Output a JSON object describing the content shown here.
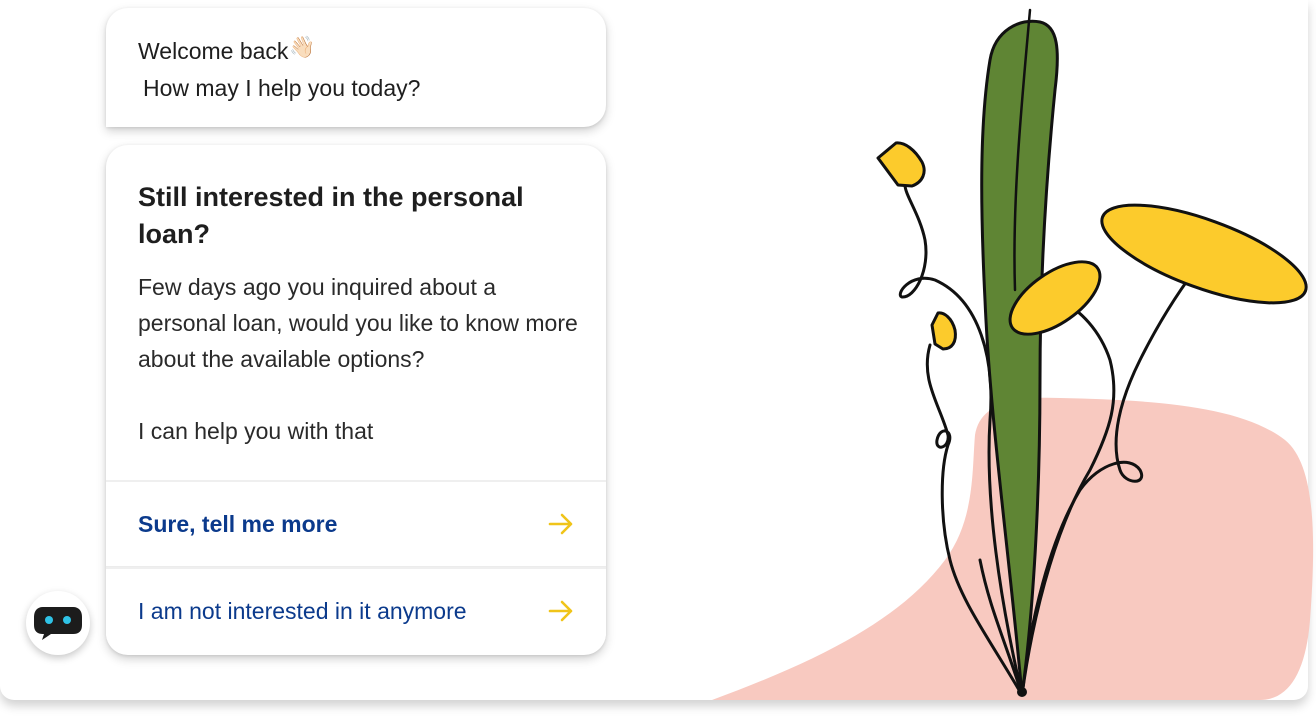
{
  "welcome": {
    "greeting": "Welcome back",
    "wave_emoji": "👋🏻",
    "question": "How may I help you today?"
  },
  "offer": {
    "title": "Still interested in the personal loan?",
    "body_lines": [
      "Few days ago you inquired about a personal loan, would you like to know more about the available options?",
      "I can help you with that"
    ]
  },
  "options": [
    {
      "label": "Sure, tell me more",
      "icon": "arrow-right-icon"
    },
    {
      "label": "I am not interested in it anymore",
      "icon": "arrow-right-icon"
    }
  ],
  "bot": {
    "icon": "chatbot-icon"
  },
  "colors": {
    "option_text": "#0b3a8c",
    "arrow": "#f0c419",
    "leaf_green": "#5f8534",
    "flower_yellow": "#fccb2c",
    "blob_pink": "#f8c9c0",
    "bot_dark": "#1c1c1c",
    "bot_eyes": "#2fc3e6"
  }
}
